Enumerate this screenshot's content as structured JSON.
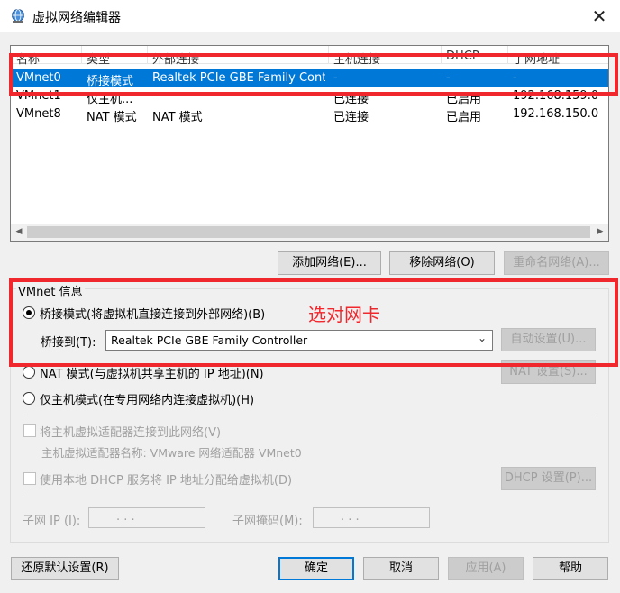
{
  "window": {
    "title": "虚拟网络编辑器",
    "close_glyph": "✕"
  },
  "table": {
    "columns": [
      "名称",
      "类型",
      "外部连接",
      "主机连接",
      "DHCP",
      "子网地址"
    ],
    "rows": [
      {
        "name": "VMnet0",
        "type": "桥接模式",
        "external": "Realtek PCIe GBE Family Contr...",
        "host": "-",
        "dhcp": "-",
        "subnet": "-"
      },
      {
        "name": "VMnet1",
        "type": "仅主机...",
        "external": "-",
        "host": "已连接",
        "dhcp": "已启用",
        "subnet": "192.168.159.0"
      },
      {
        "name": "VMnet8",
        "type": "NAT 模式",
        "external": "NAT 模式",
        "host": "已连接",
        "dhcp": "已启用",
        "subnet": "192.168.150.0"
      }
    ],
    "selected_row": 0
  },
  "net_buttons": {
    "add": "添加网络(E)...",
    "remove": "移除网络(O)",
    "rename": "重命名网络(A)..."
  },
  "vmnet_info": {
    "label": "VMnet 信息",
    "bridged_label": "桥接模式(将虚拟机直接连接到外部网络)(B)",
    "bridge_to_label": "桥接到(T):",
    "bridge_to_value": "Realtek PCIe GBE Family Controller",
    "auto_settings": "自动设置(U)...",
    "nat_label": "NAT 模式(与虚拟机共享主机的 IP 地址)(N)",
    "nat_settings": "NAT 设置(S)...",
    "hostonly_label": "仅主机模式(在专用网络内连接虚拟机)(H)",
    "connect_adapter_label": "将主机虚拟适配器连接到此网络(V)",
    "adapter_name_label": "主机虚拟适配器名称: VMware 网络适配器 VMnet0",
    "dhcp_label": "使用本地 DHCP 服务将 IP 地址分配给虚拟机(D)",
    "dhcp_settings": "DHCP 设置(P)...",
    "subnet_ip_label": "子网 IP (I):",
    "subnet_mask_label": "子网掩码(M):",
    "ip_dots": ".     .     ."
  },
  "footer": {
    "restore": "还原默认设置(R)",
    "ok": "确定",
    "cancel": "取消",
    "apply": "应用(A)",
    "help": "帮助"
  },
  "annotation": {
    "text": "选对网卡",
    "color": "#f0272c"
  },
  "colors": {
    "selection": "#0078d7",
    "annotation": "#f0272c"
  }
}
